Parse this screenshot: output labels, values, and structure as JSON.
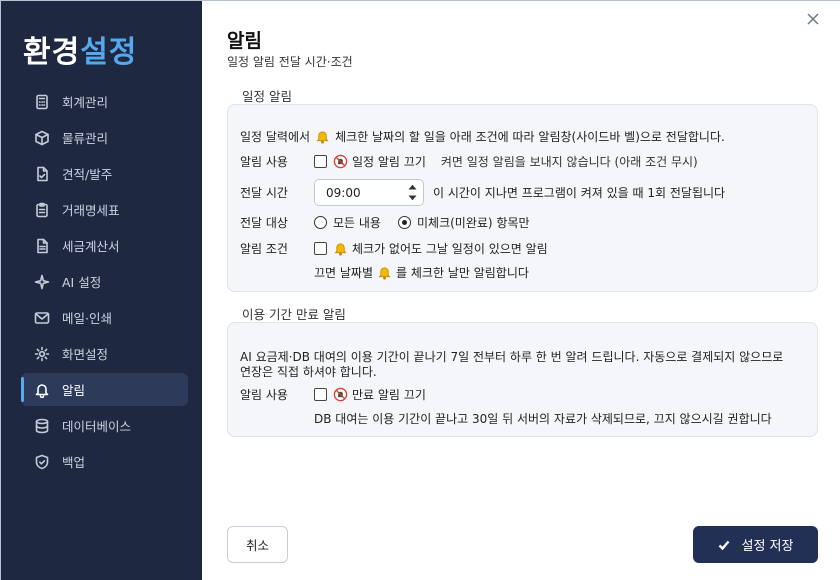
{
  "brand": {
    "part1": "환경",
    "part2": "설정"
  },
  "sidebar": {
    "items": [
      {
        "label": "회계관리",
        "icon": "calculator-icon"
      },
      {
        "label": "물류관리",
        "icon": "box-icon"
      },
      {
        "label": "견적/발주",
        "icon": "document-check-icon"
      },
      {
        "label": "거래명세표",
        "icon": "clipboard-icon"
      },
      {
        "label": "세금계산서",
        "icon": "receipt-icon"
      },
      {
        "label": "AI 설정",
        "icon": "sparkle-icon"
      },
      {
        "label": "메일·인쇄",
        "icon": "mail-icon"
      },
      {
        "label": "화면설정",
        "icon": "gear-icon"
      },
      {
        "label": "알림",
        "icon": "bell-icon",
        "active": true
      },
      {
        "label": "데이터베이스",
        "icon": "database-icon"
      },
      {
        "label": "백업",
        "icon": "shield-icon"
      }
    ]
  },
  "header": {
    "title": "알림",
    "subtitle": "일정 알림 전달 시간·조건"
  },
  "schedule": {
    "section_label": "일정 알림",
    "description_pre": "일정 달력에서",
    "description_post": "체크한 날짜의 할 일을 아래 조건에 따라 알림창(사이드바 벨)으로 전달합니다.",
    "enable_label": "알림 사용",
    "enable_option": "일정 알림 끄기",
    "enable_note": "켜면 일정 알림을 보내지 않습니다 (아래 조건 무시)",
    "time_label": "전달 시간",
    "time_value": "09:00",
    "time_note": "이 시간이 지나면 프로그램이 켜져 있을 때 1회 전달됩니다",
    "target_label": "전달 대상",
    "target_options": [
      "모든 내용",
      "미체크(미완료) 항목만"
    ],
    "target_selected": "미체크(미완료) 항목만",
    "condition_label": "알림 조건",
    "condition_option": "체크가 없어도 그날 일정이 있으면 알림",
    "condition_note_pre": "끄면 날짜별",
    "condition_note_post": "를 체크한 날만 알림합니다"
  },
  "expiry": {
    "section_label": "이용 기간 만료 알림",
    "description_line1": "AI 요금제·DB 대여의 이용 기간이 끝나기 7일 전부터 하루 한 번 알려 드립니다. 자동으로 결제되지 않으므로",
    "description_line2": "연장은 직접 하셔야 합니다.",
    "enable_label": "알림 사용",
    "enable_option": "만료 알림 끄기",
    "enable_note": "DB 대여는 이용 기간이 끝나고 30일 뒤 서버의 자료가 삭제되므로, 끄지 않으시길 권합니다"
  },
  "footer": {
    "cancel_label": "취소",
    "save_label": "설정 저장"
  },
  "colors": {
    "sidebar_bg": "#1e2840",
    "accent": "#56a8ee",
    "save_button": "#233056",
    "bell": "#f5b800",
    "mute_red": "#d93b30"
  }
}
